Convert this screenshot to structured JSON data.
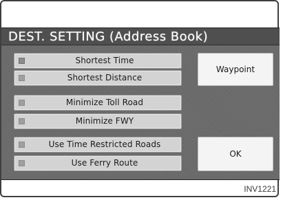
{
  "title": "DEST. SETTING (Address Book)",
  "options": [
    {
      "label": "Shortest Time",
      "indicator": "on"
    },
    {
      "label": "Shortest Distance",
      "indicator": "off"
    },
    {
      "label": "Minimize Toll Road",
      "indicator": "off"
    },
    {
      "label": "Minimize FWY",
      "indicator": "off"
    },
    {
      "label": "Use Time Restricted Roads",
      "indicator": "off"
    },
    {
      "label": "Use Ferry Route",
      "indicator": "off"
    }
  ],
  "buttons": {
    "waypoint": "Waypoint",
    "ok": "OK"
  },
  "figure_code": "INV1221",
  "colors": {
    "screen_background": "#6a6a6a",
    "title_bar": "#4f4f4f",
    "option_button": "#d3d3d3",
    "action_button": "#f4f4f4"
  }
}
